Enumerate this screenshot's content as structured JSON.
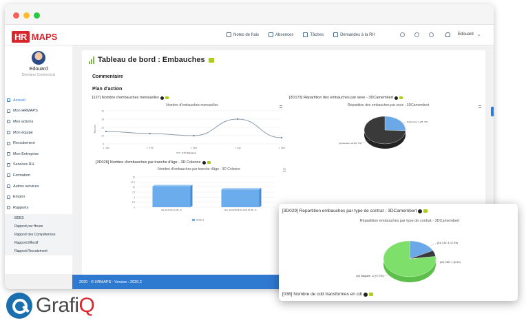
{
  "app": {
    "logo_hr": "HR",
    "logo_maps": "MAPS"
  },
  "top_nav": [
    {
      "label": "Notes de frais"
    },
    {
      "label": "Absences"
    },
    {
      "label": "Tâches"
    },
    {
      "label": "Demandes à la RH"
    }
  ],
  "user": {
    "name_top": "Edouard",
    "name": "Edouard",
    "role": "Directeur Commercial"
  },
  "sidebar": {
    "items": [
      {
        "label": "Accueil",
        "icon": "home-icon"
      },
      {
        "label": "Mon HRMAPS",
        "icon": "user-icon"
      },
      {
        "label": "Mes actions",
        "icon": "check-icon"
      },
      {
        "label": "Mon équipe",
        "icon": "team-icon"
      },
      {
        "label": "Recrutement",
        "icon": "briefcase-icon"
      },
      {
        "label": "Mon Entreprise",
        "icon": "building-icon"
      },
      {
        "label": "Services RH",
        "icon": "services-icon"
      },
      {
        "label": "Formation",
        "icon": "graduation-icon"
      },
      {
        "label": "Autres services",
        "icon": "grid-icon"
      },
      {
        "label": "Emploi",
        "icon": "job-icon"
      },
      {
        "label": "Rapports",
        "icon": "report-icon"
      }
    ],
    "subitems": [
      {
        "label": "BDES"
      },
      {
        "label": "Rapport par Heure"
      },
      {
        "label": "Rapport des Compétences"
      },
      {
        "label": "Rapport Effectif"
      },
      {
        "label": "Rapport Recrutement"
      }
    ]
  },
  "main": {
    "title": "Tableau de bord : Embauches",
    "commentaire": "Commentaire",
    "plan": "Plan d'action"
  },
  "widgets": {
    "w1": {
      "title": "[127] Nombre d'embauches mensuelles",
      "chart_title": "Nombre d'embauches mensuelles"
    },
    "w2": {
      "title": "[3D173] Répartition des embauches par sexe - 3DCamembert",
      "chart_title": "Répartition des embauches par sexe - 3DCamembert"
    },
    "w3": {
      "title": "[3D028] Nombre d'embauches par tranche d'âge - 3D Colonne",
      "chart_title": "Nombre d'embauches par tranche d'âge - 3D Colonne"
    },
    "w4": {
      "title": "[3D029] Repartition embauches par type de contrat - 3DCamembert",
      "chart_title": "Répartition embauches par type de contrat - 3DCamembert"
    },
    "w5": {
      "title": "[036] Nombre de cdd transformes en cdi"
    }
  },
  "footer": "2020 - © HRMAPS - Version : 2020.2",
  "brand": {
    "part1": "Grafi",
    "part2": "Q"
  },
  "colors": {
    "accent": "#2e7ad1",
    "logo_red": "#d7262c",
    "comment_green": "#b2cc1a",
    "pie_blue": "#6aa8e8",
    "pie_dark": "#3a3a3a",
    "pie_green": "#7ee06a"
  },
  "chart_data": [
    {
      "type": "line",
      "title": "Nombre d'embauches mensuelles",
      "ylabel": "Nombre",
      "x": [
        "1. Jan",
        "1. Feb",
        "1. Mar",
        "1. Apr",
        "1. Mai"
      ],
      "series": [
        {
          "name": "ETP Mensuel",
          "values": [
            11,
            10.5,
            10,
            14,
            9.5
          ]
        }
      ],
      "ylim": [
        8,
        16
      ],
      "yticks": [
        8,
        10,
        12,
        14,
        16
      ]
    },
    {
      "type": "pie",
      "title": "Répartition des embauches par sexe - 3DCamembert",
      "labels": [
        "(F) Femme: 4 (25 .7%)",
        "(H) Homme: 12 (84 .7%)"
      ],
      "values": [
        25.7,
        74.3
      ]
    },
    {
      "type": "bar",
      "title": "Nombre d'embauches par tranche d'âge - 3D Colonne",
      "categories": [
        "(1S-25 ANS) 10 (66 .4)",
        "(26+ 40) ENTRE 26 AND 45 (66 .4)"
      ],
      "series": [
        {
          "name": "Series 1",
          "values": [
            10.4,
            8.8
          ]
        }
      ],
      "ylim": [
        0,
        15
      ],
      "yticks": [
        0,
        2.5,
        5,
        7.5,
        10,
        12.5,
        15
      ]
    },
    {
      "type": "pie",
      "title": "Répartition embauches par type de contrat - 3DCamembert",
      "labels": [
        "(01) CDI: 3 (17.4%)",
        "(02) CDD: 1 (5.4%)",
        "(10) Stagiaire: 12 (77.2%)"
      ],
      "values": [
        17.4,
        5.4,
        77.2
      ]
    }
  ]
}
